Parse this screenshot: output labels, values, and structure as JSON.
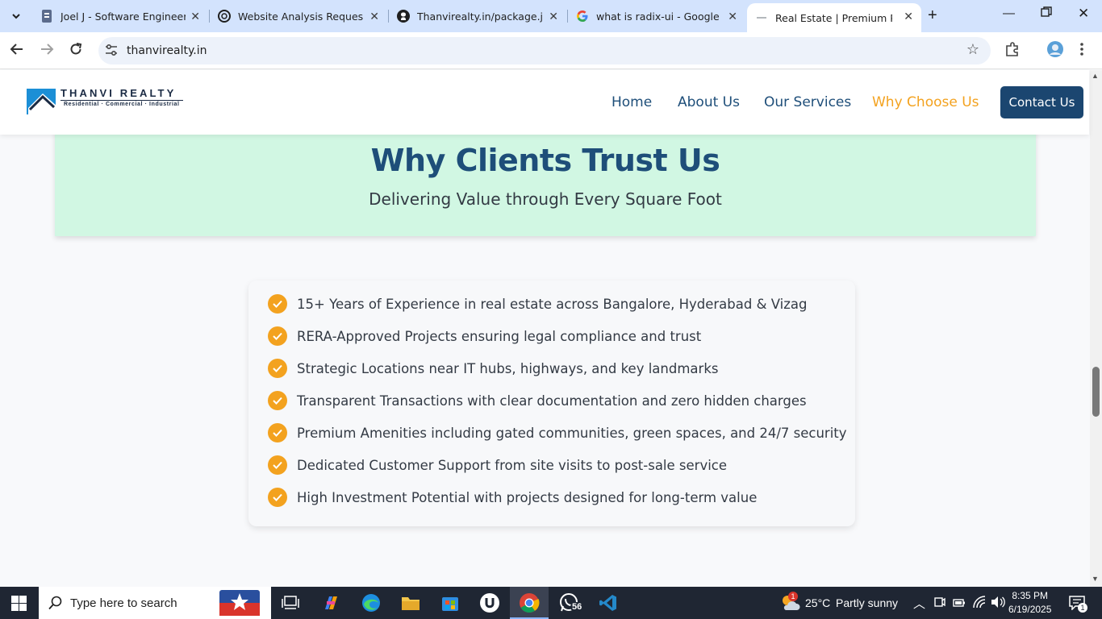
{
  "browser": {
    "tabs": [
      {
        "title": "Joel J - Software Engineer",
        "icon": "document-icon"
      },
      {
        "title": "Website Analysis Request",
        "icon": "chatgpt-icon"
      },
      {
        "title": "Thanvirealty.in/package.json",
        "icon": "github-icon"
      },
      {
        "title": "what is radix-ui - Google Sea",
        "icon": "google-icon"
      },
      {
        "title": "Real Estate | Premium Prope",
        "icon": "loading-icon"
      }
    ],
    "url": "thanvirealty.in"
  },
  "site": {
    "logo": {
      "name": "THANVI REALTY",
      "tagline": "Residential · Commercial · Industrial"
    },
    "nav": [
      "Home",
      "About Us",
      "Our Services",
      "Why Choose Us"
    ],
    "contact_label": "Contact Us",
    "colors": {
      "accent": "#f3a21f",
      "primary": "#1e4e79",
      "hero_bg": "#d1f7e3",
      "button_bg": "#1b4670"
    }
  },
  "section": {
    "title": "Why Clients Trust Us",
    "subtitle": "Delivering Value through Every Square Foot",
    "features": [
      "15+ Years of Experience in real estate across Bangalore, Hyderabad & Vizag",
      "RERA-Approved Projects ensuring legal compliance and trust",
      "Strategic Locations near IT hubs, highways, and key landmarks",
      "Transparent Transactions with clear documentation and zero hidden charges",
      "Premium Amenities including gated communities, green spaces, and 24/7 security",
      "Dedicated Customer Support from site visits to post-sale service",
      "High Investment Potential with projects designed for long-term value"
    ]
  },
  "taskbar": {
    "search_placeholder": "Type here to search",
    "whatsapp_badge": "56",
    "weather": {
      "temp": "25°C",
      "condition": "Partly sunny",
      "badge": "1"
    },
    "time": "8:35 PM",
    "date": "6/19/2025",
    "notifications": "1"
  }
}
